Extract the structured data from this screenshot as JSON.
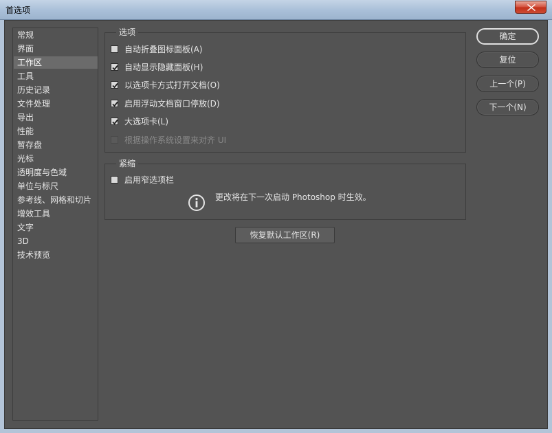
{
  "window": {
    "title": "首选项"
  },
  "sidebar": {
    "items": [
      {
        "label": "常规"
      },
      {
        "label": "界面"
      },
      {
        "label": "工作区"
      },
      {
        "label": "工具"
      },
      {
        "label": "历史记录"
      },
      {
        "label": "文件处理"
      },
      {
        "label": "导出"
      },
      {
        "label": "性能"
      },
      {
        "label": "暂存盘"
      },
      {
        "label": "光标"
      },
      {
        "label": "透明度与色域"
      },
      {
        "label": "单位与标尺"
      },
      {
        "label": "参考线、网格和切片"
      },
      {
        "label": "增效工具"
      },
      {
        "label": "文字"
      },
      {
        "label": "3D"
      },
      {
        "label": "技术预览"
      }
    ],
    "selected": "工作区"
  },
  "options_group": {
    "title": "选项",
    "items": [
      {
        "label": "自动折叠图标面板(A)",
        "checked": false,
        "enabled": true
      },
      {
        "label": "自动显示隐藏面板(H)",
        "checked": true,
        "enabled": true
      },
      {
        "label": "以选项卡方式打开文档(O)",
        "checked": true,
        "enabled": true
      },
      {
        "label": "启用浮动文档窗口停放(D)",
        "checked": true,
        "enabled": true
      },
      {
        "label": "大选项卡(L)",
        "checked": true,
        "enabled": true
      },
      {
        "label": "根据操作系统设置来对齐 UI",
        "checked": false,
        "enabled": false
      }
    ]
  },
  "compact_group": {
    "title": "紧缩",
    "items": [
      {
        "label": "启用窄选项栏",
        "checked": false,
        "enabled": true
      }
    ],
    "info_text": "更改将在下一次启动 Photoshop 时生效。"
  },
  "restore_button": {
    "label": "恢复默认工作区(R)"
  },
  "buttons": {
    "ok": "确定",
    "reset": "复位",
    "prev": "上一个(P)",
    "next": "下一个(N)"
  }
}
